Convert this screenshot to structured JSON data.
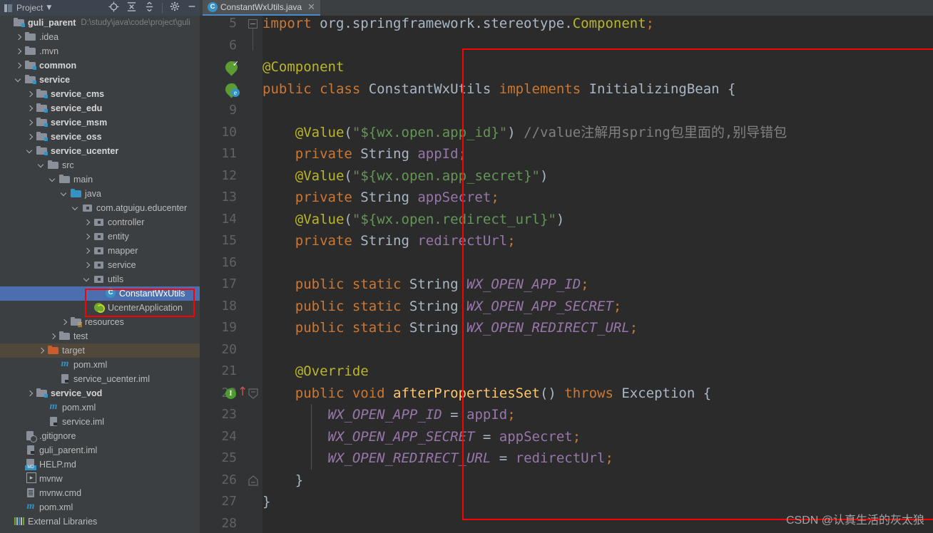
{
  "toolwindow": {
    "title": "Project",
    "dropdown_icon": "chevron-down-icon",
    "buttons": [
      {
        "name": "locate-icon",
        "glyph": "⊕"
      },
      {
        "name": "expand-all-icon",
        "glyph": "⇲"
      },
      {
        "name": "collapse-all-icon",
        "glyph": "⇱"
      },
      {
        "name": "gear-icon",
        "glyph": "✿"
      },
      {
        "name": "minimize-icon",
        "glyph": "—"
      }
    ]
  },
  "tree": {
    "root": {
      "label": "guli_parent",
      "path": "D:\\study\\java\\code\\project\\guli"
    },
    "items": [
      {
        "label": ".idea",
        "indent": 1,
        "icon": "folder",
        "arrow": "closed",
        "bold": false
      },
      {
        "label": ".mvn",
        "indent": 1,
        "icon": "folder",
        "arrow": "closed",
        "bold": false
      },
      {
        "label": "common",
        "indent": 1,
        "icon": "folder-module",
        "arrow": "closed",
        "bold": true
      },
      {
        "label": "service",
        "indent": 1,
        "icon": "folder-module",
        "arrow": "open",
        "bold": true
      },
      {
        "label": "service_cms",
        "indent": 2,
        "icon": "folder-module",
        "arrow": "closed",
        "bold": true
      },
      {
        "label": "service_edu",
        "indent": 2,
        "icon": "folder-module",
        "arrow": "closed",
        "bold": true
      },
      {
        "label": "service_msm",
        "indent": 2,
        "icon": "folder-module",
        "arrow": "closed",
        "bold": true
      },
      {
        "label": "service_oss",
        "indent": 2,
        "icon": "folder-module",
        "arrow": "closed",
        "bold": true
      },
      {
        "label": "service_ucenter",
        "indent": 2,
        "icon": "folder-module",
        "arrow": "open",
        "bold": true
      },
      {
        "label": "src",
        "indent": 3,
        "icon": "folder",
        "arrow": "open",
        "bold": false
      },
      {
        "label": "main",
        "indent": 4,
        "icon": "folder",
        "arrow": "open",
        "bold": false
      },
      {
        "label": "java",
        "indent": 5,
        "icon": "folder-source",
        "arrow": "open",
        "bold": false
      },
      {
        "label": "com.atguigu.educenter",
        "indent": 6,
        "icon": "package",
        "arrow": "open",
        "bold": false
      },
      {
        "label": "controller",
        "indent": 7,
        "icon": "package",
        "arrow": "closed",
        "bold": false
      },
      {
        "label": "entity",
        "indent": 7,
        "icon": "package",
        "arrow": "closed",
        "bold": false
      },
      {
        "label": "mapper",
        "indent": 7,
        "icon": "package",
        "arrow": "closed",
        "bold": false
      },
      {
        "label": "service",
        "indent": 7,
        "icon": "package",
        "arrow": "closed",
        "bold": false
      },
      {
        "label": "utils",
        "indent": 7,
        "icon": "package",
        "arrow": "open",
        "bold": false
      },
      {
        "label": "ConstantWxUtils",
        "indent": 8,
        "icon": "class",
        "arrow": "none",
        "bold": false,
        "selected": true
      },
      {
        "label": "UcenterApplication",
        "indent": 7,
        "icon": "spring-class",
        "arrow": "none",
        "bold": false
      },
      {
        "label": "resources",
        "indent": 5,
        "icon": "folder-resources",
        "arrow": "closed",
        "bold": false
      },
      {
        "label": "test",
        "indent": 4,
        "icon": "folder",
        "arrow": "closed",
        "bold": false
      },
      {
        "label": "target",
        "indent": 3,
        "icon": "folder-target",
        "arrow": "closed",
        "bold": false,
        "excluded": true
      },
      {
        "label": "pom.xml",
        "indent": 4,
        "icon": "maven",
        "arrow": "none",
        "bold": false
      },
      {
        "label": "service_ucenter.iml",
        "indent": 4,
        "icon": "iml",
        "arrow": "none",
        "bold": false
      },
      {
        "label": "service_vod",
        "indent": 2,
        "icon": "folder-module",
        "arrow": "closed",
        "bold": true
      },
      {
        "label": "pom.xml",
        "indent": 3,
        "icon": "maven",
        "arrow": "none",
        "bold": false
      },
      {
        "label": "service.iml",
        "indent": 3,
        "icon": "iml",
        "arrow": "none",
        "bold": false
      },
      {
        "label": ".gitignore",
        "indent": 1,
        "icon": "gitignore",
        "arrow": "none",
        "bold": false
      },
      {
        "label": "guli_parent.iml",
        "indent": 1,
        "icon": "iml",
        "arrow": "none",
        "bold": false
      },
      {
        "label": "HELP.md",
        "indent": 1,
        "icon": "markdown",
        "arrow": "none",
        "bold": false
      },
      {
        "label": "mvnw",
        "indent": 1,
        "icon": "executable",
        "arrow": "none",
        "bold": false
      },
      {
        "label": "mvnw.cmd",
        "indent": 1,
        "icon": "cmd",
        "arrow": "none",
        "bold": false
      },
      {
        "label": "pom.xml",
        "indent": 1,
        "icon": "maven",
        "arrow": "none",
        "bold": false
      },
      {
        "label": "External Libraries",
        "indent": 0,
        "icon": "libraries",
        "arrow": "none",
        "bold": false
      }
    ]
  },
  "editor": {
    "tab": {
      "label": "ConstantWxUtils.java",
      "icon": "java-class-icon",
      "close_glyph": "✕"
    },
    "first_visible_line": 5,
    "last_visible_line": 28,
    "lines": [
      {
        "n": 5,
        "tokens": [
          {
            "t": "import ",
            "c": "kw"
          },
          {
            "t": "org.springframework.stereotype.",
            "c": "cls"
          },
          {
            "t": "Component",
            "c": "ann"
          },
          {
            "t": ";",
            "c": "semi"
          }
        ]
      },
      {
        "n": 6,
        "tokens": []
      },
      {
        "n": 7,
        "tokens": [
          {
            "t": "@Component",
            "c": "ann"
          }
        ]
      },
      {
        "n": 8,
        "tokens": [
          {
            "t": "public class ",
            "c": "kw"
          },
          {
            "t": "ConstantWxUtils ",
            "c": "cls"
          },
          {
            "t": "implements ",
            "c": "kw"
          },
          {
            "t": "InitializingBean {",
            "c": "cls"
          }
        ]
      },
      {
        "n": 9,
        "tokens": []
      },
      {
        "n": 10,
        "tokens": [
          {
            "t": "    ",
            "c": "punc"
          },
          {
            "t": "@Value",
            "c": "ann"
          },
          {
            "t": "(",
            "c": "punc"
          },
          {
            "t": "\"",
            "c": "str"
          },
          {
            "t": "${wx.open.app_id}",
            "c": "tmpl"
          },
          {
            "t": "\"",
            "c": "str"
          },
          {
            "t": ")",
            "c": "punc"
          },
          {
            "t": " //value注解用spring包里面的,别导错包",
            "c": "cmt"
          }
        ]
      },
      {
        "n": 11,
        "tokens": [
          {
            "t": "    ",
            "c": "punc"
          },
          {
            "t": "private ",
            "c": "kw"
          },
          {
            "t": "String ",
            "c": "cls"
          },
          {
            "t": "appId",
            "c": "fld"
          },
          {
            "t": ";",
            "c": "semi"
          }
        ]
      },
      {
        "n": 12,
        "tokens": [
          {
            "t": "    ",
            "c": "punc"
          },
          {
            "t": "@Value",
            "c": "ann"
          },
          {
            "t": "(",
            "c": "punc"
          },
          {
            "t": "\"",
            "c": "str"
          },
          {
            "t": "${wx.open.app_secret}",
            "c": "tmpl"
          },
          {
            "t": "\"",
            "c": "str"
          },
          {
            "t": ")",
            "c": "punc"
          }
        ]
      },
      {
        "n": 13,
        "tokens": [
          {
            "t": "    ",
            "c": "punc"
          },
          {
            "t": "private ",
            "c": "kw"
          },
          {
            "t": "String ",
            "c": "cls"
          },
          {
            "t": "appSecret",
            "c": "fld"
          },
          {
            "t": ";",
            "c": "semi"
          }
        ]
      },
      {
        "n": 14,
        "tokens": [
          {
            "t": "    ",
            "c": "punc"
          },
          {
            "t": "@Value",
            "c": "ann"
          },
          {
            "t": "(",
            "c": "punc"
          },
          {
            "t": "\"",
            "c": "str"
          },
          {
            "t": "${wx.open.redirect_url}",
            "c": "tmpl"
          },
          {
            "t": "\"",
            "c": "str"
          },
          {
            "t": ")",
            "c": "punc"
          }
        ]
      },
      {
        "n": 15,
        "tokens": [
          {
            "t": "    ",
            "c": "punc"
          },
          {
            "t": "private ",
            "c": "kw"
          },
          {
            "t": "String ",
            "c": "cls"
          },
          {
            "t": "redirectUrl",
            "c": "fld"
          },
          {
            "t": ";",
            "c": "semi"
          }
        ]
      },
      {
        "n": 16,
        "tokens": []
      },
      {
        "n": 17,
        "tokens": [
          {
            "t": "    ",
            "c": "punc"
          },
          {
            "t": "public static ",
            "c": "kw"
          },
          {
            "t": "String ",
            "c": "cls"
          },
          {
            "t": "WX_OPEN_APP_ID",
            "c": "stat"
          },
          {
            "t": ";",
            "c": "semi"
          }
        ]
      },
      {
        "n": 18,
        "tokens": [
          {
            "t": "    ",
            "c": "punc"
          },
          {
            "t": "public static ",
            "c": "kw"
          },
          {
            "t": "String ",
            "c": "cls"
          },
          {
            "t": "WX_OPEN_APP_SECRET",
            "c": "stat"
          },
          {
            "t": ";",
            "c": "semi"
          }
        ]
      },
      {
        "n": 19,
        "tokens": [
          {
            "t": "    ",
            "c": "punc"
          },
          {
            "t": "public static ",
            "c": "kw"
          },
          {
            "t": "String ",
            "c": "cls"
          },
          {
            "t": "WX_OPEN_REDIRECT_URL",
            "c": "stat"
          },
          {
            "t": ";",
            "c": "semi"
          }
        ]
      },
      {
        "n": 20,
        "tokens": []
      },
      {
        "n": 21,
        "tokens": [
          {
            "t": "    ",
            "c": "punc"
          },
          {
            "t": "@Override",
            "c": "ann"
          }
        ]
      },
      {
        "n": 22,
        "tokens": [
          {
            "t": "    ",
            "c": "punc"
          },
          {
            "t": "public void ",
            "c": "kw"
          },
          {
            "t": "afterPropertiesSet",
            "c": "mth"
          },
          {
            "t": "() ",
            "c": "punc"
          },
          {
            "t": "throws ",
            "c": "kw"
          },
          {
            "t": "Exception {",
            "c": "cls"
          }
        ]
      },
      {
        "n": 23,
        "tokens": [
          {
            "t": "        ",
            "c": "punc"
          },
          {
            "t": "WX_OPEN_APP_ID ",
            "c": "stat"
          },
          {
            "t": "= ",
            "c": "punc"
          },
          {
            "t": "appId",
            "c": "fld"
          },
          {
            "t": ";",
            "c": "semi"
          }
        ]
      },
      {
        "n": 24,
        "tokens": [
          {
            "t": "        ",
            "c": "punc"
          },
          {
            "t": "WX_OPEN_APP_SECRET ",
            "c": "stat"
          },
          {
            "t": "= ",
            "c": "punc"
          },
          {
            "t": "appSecret",
            "c": "fld"
          },
          {
            "t": ";",
            "c": "semi"
          }
        ]
      },
      {
        "n": 25,
        "tokens": [
          {
            "t": "        ",
            "c": "punc"
          },
          {
            "t": "WX_OPEN_REDIRECT_URL ",
            "c": "stat"
          },
          {
            "t": "= ",
            "c": "punc"
          },
          {
            "t": "redirectUrl",
            "c": "fld"
          },
          {
            "t": ";",
            "c": "semi"
          }
        ]
      },
      {
        "n": 26,
        "tokens": [
          {
            "t": "    }",
            "c": "cls"
          }
        ]
      },
      {
        "n": 27,
        "tokens": [
          {
            "t": "}",
            "c": "cls"
          }
        ]
      },
      {
        "n": 28,
        "tokens": []
      }
    ],
    "gutter_markers": [
      {
        "line": 7,
        "type": "spring-bean-icon",
        "title": "bean-check"
      },
      {
        "line": 8,
        "type": "spring-bean-editor-icon",
        "title": "bean-config"
      },
      {
        "line": 22,
        "type": "implementing-method-icon",
        "glyph": "I"
      }
    ]
  },
  "annotations": {
    "box_color": "#ff0000",
    "watermark": "CSDN @认真生活的灰太狼"
  }
}
